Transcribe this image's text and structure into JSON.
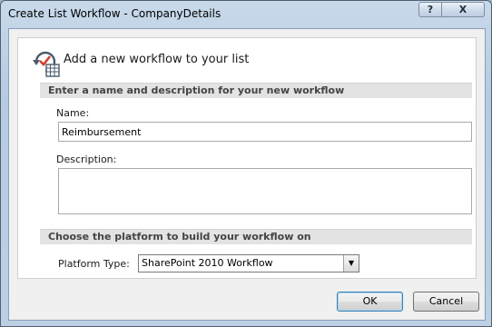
{
  "window": {
    "title": "Create List Workflow - CompanyDetails",
    "help_glyph": "?",
    "close_glyph": "X"
  },
  "header": {
    "icon": "workflow-icon",
    "text": "Add a new workflow to your list"
  },
  "section_name": {
    "title": "Enter a name and description for your new workflow"
  },
  "name_field": {
    "label": "Name:",
    "value": "Reimbursement"
  },
  "description_field": {
    "label": "Description:",
    "value": ""
  },
  "section_platform": {
    "title": "Choose the platform to build your workflow on"
  },
  "platform": {
    "label": "Platform Type:",
    "selected": "SharePoint 2010 Workflow"
  },
  "buttons": {
    "ok": "OK",
    "cancel": "Cancel"
  },
  "colors": {
    "title_bar": "#b5cbe2",
    "section_bar": "#e3e3e3",
    "default_button_border": "#3c7fb1"
  }
}
